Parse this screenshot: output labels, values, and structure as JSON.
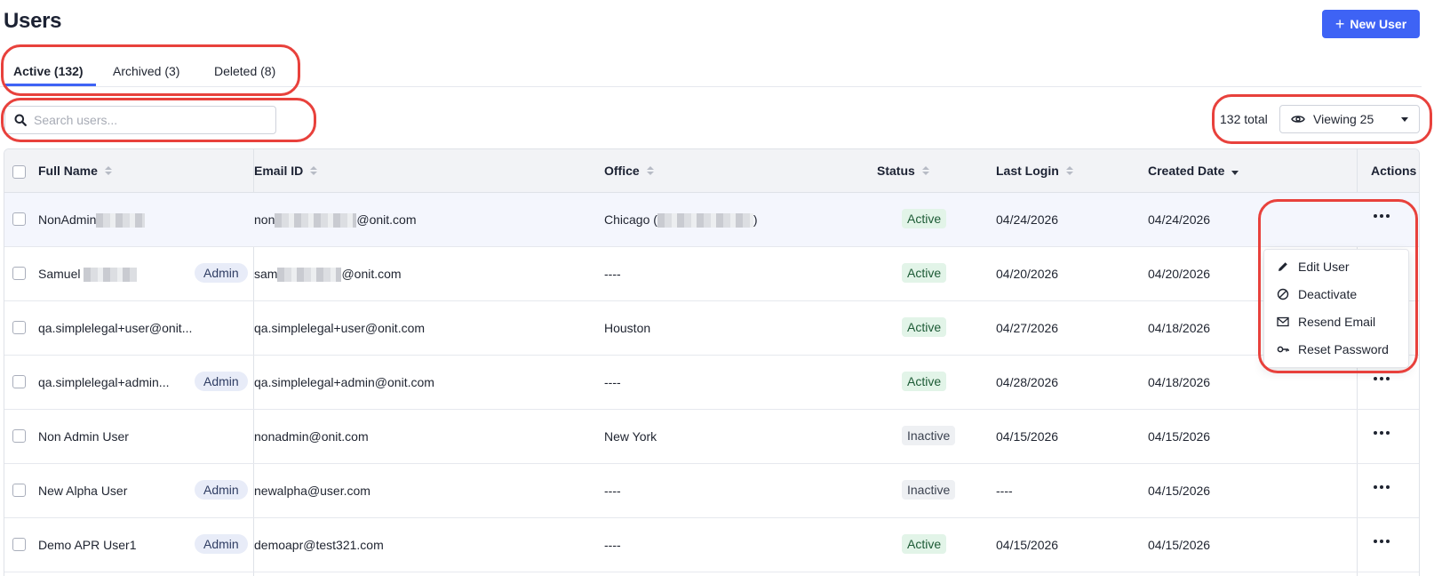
{
  "header": {
    "title": "Users",
    "new_user_label": "New User"
  },
  "tabs": [
    {
      "label": "Active (132)",
      "active": true
    },
    {
      "label": "Archived (3)",
      "active": false
    },
    {
      "label": "Deleted (8)",
      "active": false
    }
  ],
  "search": {
    "placeholder": "Search users..."
  },
  "pagination": {
    "total_label": "132 total",
    "viewing_label": "Viewing 25"
  },
  "table": {
    "columns": [
      "Full Name",
      "Email ID",
      "Office",
      "Status",
      "Last Login",
      "Created Date",
      "Actions"
    ],
    "sort_active_column": "Created Date",
    "rows": [
      {
        "name": "NonAdmin",
        "admin": "",
        "email_pre": "non",
        "email_post": "@onit.com",
        "office": "Chicago (",
        "office_post": ")",
        "status": "Active",
        "last_login": "04/24/2026",
        "created": "04/24/2026"
      },
      {
        "name": "Samuel",
        "admin": "Admin",
        "email_pre": "sam",
        "email_post": "@onit.com",
        "office": "----",
        "office_post": "",
        "status": "Active",
        "last_login": "04/20/2026",
        "created": "04/20/2026"
      },
      {
        "name": "qa.simplelegal+user@onit...",
        "admin": "",
        "email_pre": "qa.simplelegal+user@onit.com",
        "email_post": "",
        "office": "Houston",
        "office_post": "",
        "status": "Active",
        "last_login": "04/27/2026",
        "created": "04/18/2026"
      },
      {
        "name": "qa.simplelegal+admin...",
        "admin": "Admin",
        "email_pre": "qa.simplelegal+admin@onit.com",
        "email_post": "",
        "office": "----",
        "office_post": "",
        "status": "Active",
        "last_login": "04/28/2026",
        "created": "04/18/2026"
      },
      {
        "name": "Non Admin User",
        "admin": "",
        "email_pre": "nonadmin@onit.com",
        "email_post": "",
        "office": "New York",
        "office_post": "",
        "status": "Inactive",
        "last_login": "04/15/2026",
        "created": "04/15/2026"
      },
      {
        "name": "New Alpha User",
        "admin": "Admin",
        "email_pre": "newalpha@user.com",
        "email_post": "",
        "office": "----",
        "office_post": "",
        "status": "Inactive",
        "last_login": "----",
        "created": "04/15/2026"
      },
      {
        "name": "Demo APR User1",
        "admin": "Admin",
        "email_pre": "demoapr@test321.com",
        "email_post": "",
        "office": "----",
        "office_post": "",
        "status": "Active",
        "last_login": "04/15/2026",
        "created": "04/15/2026"
      }
    ]
  },
  "actions_menu": {
    "items": [
      {
        "label": "Edit User",
        "icon": "pencil-icon"
      },
      {
        "label": "Deactivate",
        "icon": "ban-icon"
      },
      {
        "label": "Resend Email",
        "icon": "envelope-icon"
      },
      {
        "label": "Reset Password",
        "icon": "key-icon"
      }
    ]
  },
  "colors": {
    "accent": "#3e63f5",
    "active_bg": "#e2f4e8",
    "inactive_bg": "#eef0f3",
    "annotation": "#e8413c"
  }
}
